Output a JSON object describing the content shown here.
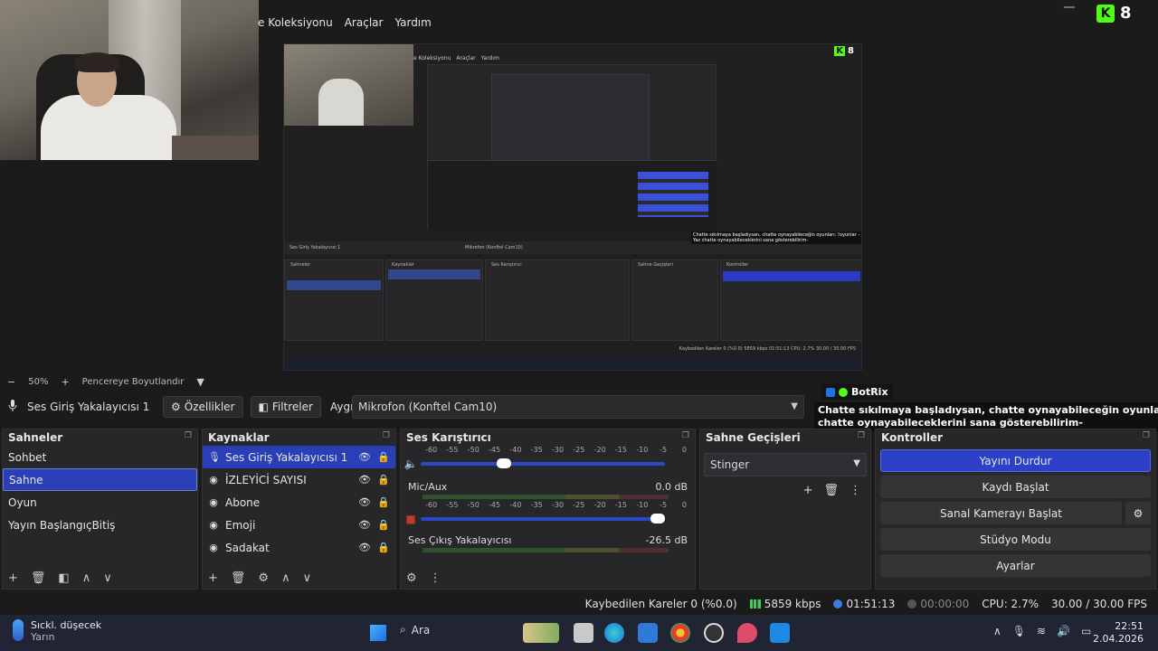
{
  "menu": [
    "e Koleksiyonu",
    "Araçlar",
    "Yardım"
  ],
  "window": {
    "minimize": "—"
  },
  "kick": {
    "logo": "K",
    "count": "8",
    "close": "×"
  },
  "preview": {
    "menu": [
      "e Koleksiyonu",
      "Araçlar",
      "Yardım"
    ],
    "source_name": "Ses Giriş Yakalayıcısı 1",
    "device": "Mikrofon (Konftel Cam10)",
    "scenes_title": "Sahneler",
    "sources_title": "Kaynaklar",
    "mixer_title": "Ses Karıştırıcı",
    "transitions_title": "Sahne Geçişleri",
    "controls_title": "Kontroller",
    "status": "Kaybedilen Kareler 0 (%0.0)  5859 kbps  01:51:13  CPU: 2.7%  30.00 / 30.00 FPS",
    "botrix": "Chatte sıkılmaya başladıysan, chatte oynayabileceğin oyunları: !oyunlar -Yaz chatte oynayabileceklerini sana gösterebilirim-"
  },
  "zoom": {
    "minus": "−",
    "level": "50%",
    "plus": "+",
    "fit": "Pencereye Boyutlandır",
    "caret": "▼"
  },
  "source_toolbar": {
    "mic_icon": "mic-icon",
    "source_name": "Ses Giriş Yakalayıcısı 1",
    "properties": "Özellikler",
    "filters": "Filtreler",
    "device_label": "Aygıt",
    "device_value": "Mikrofon (Konftel Cam10)"
  },
  "botrix": {
    "name": "BotRix",
    "line1": "Chatte sıkılmaya başladıysan, chatte oynayabileceğin oyunları: !oyunlar -Yaz",
    "line2": "chatte oynayabileceklerini sana gösterebilirim-"
  },
  "scenes": {
    "title": "Sahneler",
    "items": [
      "Sohbet",
      "Sahne",
      "Oyun",
      "Yayın BaşlangıçBitiş"
    ],
    "selected_index": 1
  },
  "sources": {
    "title": "Kaynaklar",
    "items": [
      {
        "name": "Ses Giriş Yakalayıcısı 1",
        "icon": "mic-icon"
      },
      {
        "name": "İZLEYİCİ SAYISI",
        "icon": "globe-icon"
      },
      {
        "name": "Abone",
        "icon": "globe-icon"
      },
      {
        "name": "Emoji",
        "icon": "globe-icon"
      },
      {
        "name": "Sadakat",
        "icon": "globe-icon"
      }
    ],
    "selected_index": 0
  },
  "mixer": {
    "title": "Ses Karıştırıcı",
    "scale": [
      "-60",
      "-55",
      "-50",
      "-45",
      "-40",
      "-35",
      "-30",
      "-25",
      "-20",
      "-15",
      "-10",
      "-5",
      "0"
    ],
    "channels": [
      {
        "name": "",
        "db": "",
        "volume": 0.33,
        "muted": false
      },
      {
        "name": "Mic/Aux",
        "db": "0.0 dB",
        "volume": 1.0,
        "muted": true
      },
      {
        "name": "Ses Çıkış Yakalayıcısı",
        "db": "-26.5 dB",
        "volume": 0.6,
        "muted": false
      }
    ]
  },
  "transitions": {
    "title": "Sahne Geçişleri",
    "selected": "Stinger"
  },
  "controls": {
    "title": "Kontroller",
    "stop_stream": "Yayını Durdur",
    "start_record": "Kaydı Başlat",
    "virtual_cam": "Sanal Kamerayı Başlat",
    "studio_mode": "Stüdyo Modu",
    "settings": "Ayarlar"
  },
  "status": {
    "dropped": "Kaybedilen Kareler 0 (%0.0)",
    "bitrate": "5859 kbps",
    "live_time": "01:51:13",
    "rec_time": "00:00:00",
    "cpu": "CPU: 2.7%",
    "fps": "30.00 / 30.00 FPS"
  },
  "taskbar": {
    "weather_title": "Sıckl. düşecek",
    "weather_sub": "Yarın",
    "search": "Ara",
    "time": "22:51",
    "date": "2.04.2026"
  },
  "colors": {
    "accent": "#2c40c8",
    "panel": "#27272a",
    "kick": "#53fc18"
  }
}
